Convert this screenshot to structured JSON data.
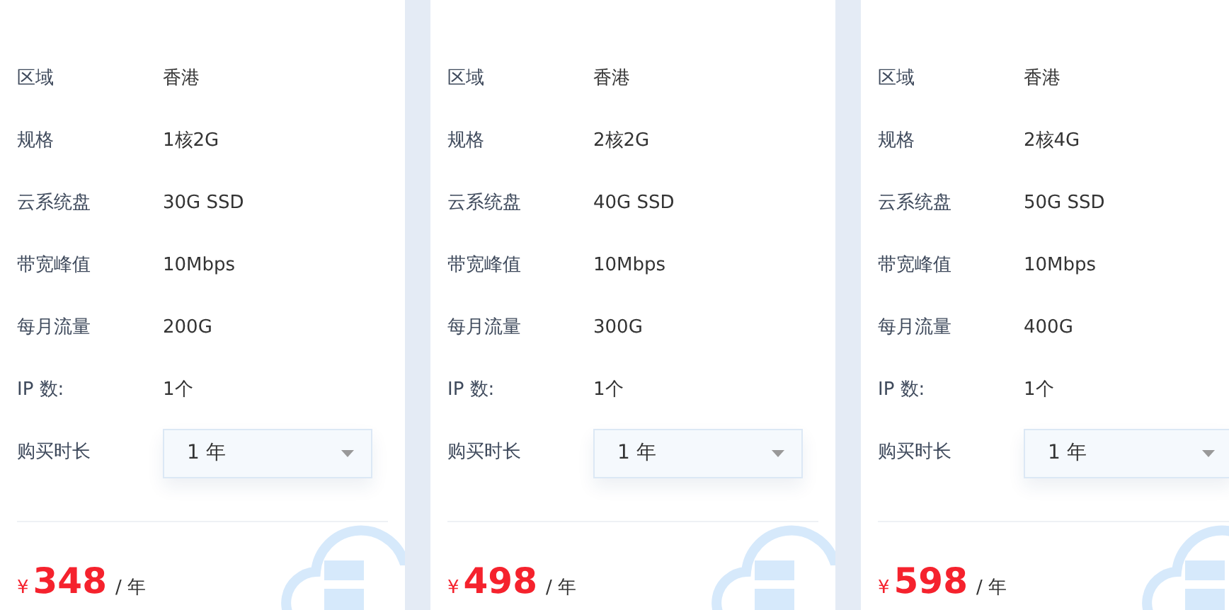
{
  "plans": [
    {
      "specs": [
        {
          "label": "区域",
          "value": "香港"
        },
        {
          "label": "规格",
          "value": "1核2G"
        },
        {
          "label": "云系统盘",
          "value": "30G SSD"
        },
        {
          "label": "带宽峰值",
          "value": "10Mbps"
        },
        {
          "label": "每月流量",
          "value": "200G"
        },
        {
          "label": "IP 数:",
          "value": "1个"
        }
      ],
      "duration": {
        "label": "购买时长",
        "value": "1 年"
      },
      "price": {
        "currency": "¥",
        "amount": "348",
        "unit": "/ 年"
      }
    },
    {
      "specs": [
        {
          "label": "区域",
          "value": "香港"
        },
        {
          "label": "规格",
          "value": "2核2G"
        },
        {
          "label": "云系统盘",
          "value": "40G SSD"
        },
        {
          "label": "带宽峰值",
          "value": "10Mbps"
        },
        {
          "label": "每月流量",
          "value": "300G"
        },
        {
          "label": "IP 数:",
          "value": "1个"
        }
      ],
      "duration": {
        "label": "购买时长",
        "value": "1 年"
      },
      "price": {
        "currency": "¥",
        "amount": "498",
        "unit": "/ 年"
      }
    },
    {
      "specs": [
        {
          "label": "区域",
          "value": "香港"
        },
        {
          "label": "规格",
          "value": "2核4G"
        },
        {
          "label": "云系统盘",
          "value": "50G SSD"
        },
        {
          "label": "带宽峰值",
          "value": "10Mbps"
        },
        {
          "label": "每月流量",
          "value": "400G"
        },
        {
          "label": "IP 数:",
          "value": "1个"
        }
      ],
      "duration": {
        "label": "购买时长",
        "value": "1 年"
      },
      "price": {
        "currency": "¥",
        "amount": "598",
        "unit": "/ 年"
      }
    }
  ]
}
